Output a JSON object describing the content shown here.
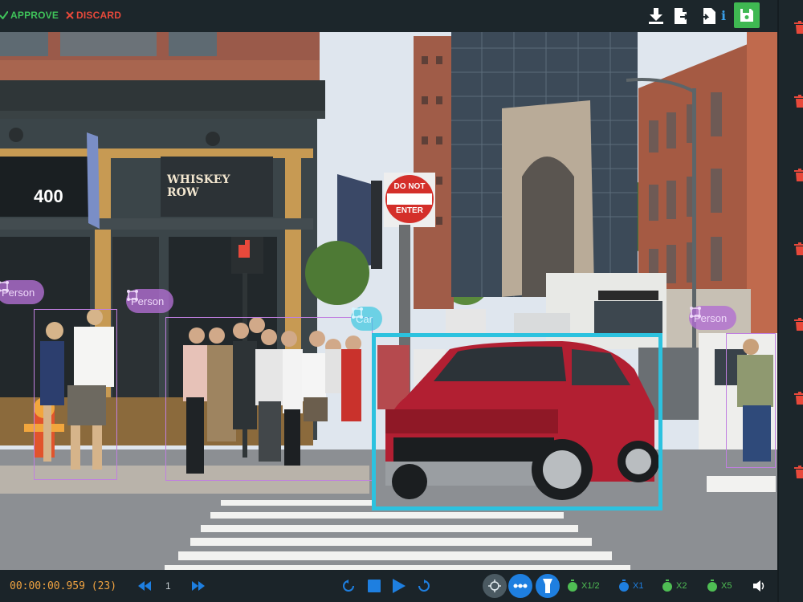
{
  "toolbar": {
    "approve_label": "APPROVE",
    "discard_label": "DISCARD",
    "icons": [
      "download-icon",
      "export-file-icon",
      "import-icon",
      "info-icon",
      "save-icon"
    ],
    "info_glyph": "i"
  },
  "scene": {
    "building_number": "400",
    "store_sign": "WHISKEY ROW",
    "sign_line1": "DO NOT",
    "sign_line2": "ENTER",
    "annotations": [
      {
        "label": "Person"
      },
      {
        "label": "Person"
      },
      {
        "label": "Car"
      },
      {
        "label": "Person"
      }
    ]
  },
  "player": {
    "timecode": "00:00:00.959 (23)",
    "frame_step": "1",
    "speeds": [
      {
        "label": "X1/2"
      },
      {
        "label": "X1"
      },
      {
        "label": "X2"
      },
      {
        "label": "X5"
      }
    ]
  },
  "colors": {
    "approve": "#3fc35a",
    "discard": "#e8493b",
    "person_tag": "#b26ed2",
    "car_box": "#2cc2df",
    "timecode": "#f0a341",
    "accent_blue": "#1e7fe0",
    "trash": "#e8493b"
  }
}
